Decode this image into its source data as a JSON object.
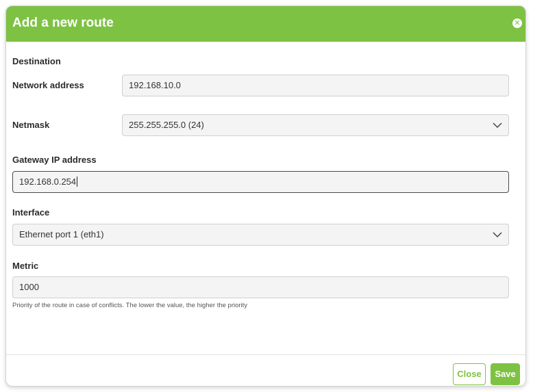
{
  "dialog": {
    "title": "Add a new route",
    "close_icon": "close-circle-icon",
    "accent_color": "#7dc242"
  },
  "destination": {
    "section_label": "Destination",
    "network_address_label": "Network address",
    "network_address_value": "192.168.10.0",
    "netmask_label": "Netmask",
    "netmask_value": "255.255.255.0 (24)"
  },
  "gateway": {
    "label": "Gateway IP address",
    "value": "192.168.0.254"
  },
  "interface": {
    "label": "Interface",
    "value": "Ethernet port 1 (eth1)"
  },
  "metric": {
    "label": "Metric",
    "value": "1000",
    "hint": "Priority of the route in case of conflicts. The lower the value, the higher the priority"
  },
  "footer": {
    "close_label": "Close",
    "save_label": "Save"
  }
}
